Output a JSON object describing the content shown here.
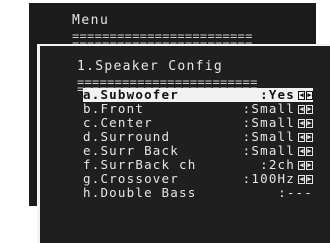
{
  "back_menu": {
    "title": "Menu",
    "separator": "========================"
  },
  "speaker_config": {
    "title": "1.Speaker Config",
    "separator": "========================",
    "items": [
      {
        "label": "a.Subwoofer",
        "value": ":Yes",
        "arrows": true,
        "selected": true
      },
      {
        "label": "b.Front",
        "value": ":Small",
        "arrows": true,
        "selected": false
      },
      {
        "label": "c.Center",
        "value": ":Small",
        "arrows": true,
        "selected": false
      },
      {
        "label": "d.Surround",
        "value": ":Small",
        "arrows": true,
        "selected": false
      },
      {
        "label": "e.Surr Back",
        "value": ":Small",
        "arrows": true,
        "selected": false
      },
      {
        "label": "f.SurrBack ch",
        "value": ":2ch",
        "arrows": true,
        "selected": false
      },
      {
        "label": "g.Crossover",
        "value": ":100Hz",
        "arrows": true,
        "selected": false
      },
      {
        "label": "h.Double Bass",
        "value": ":---",
        "arrows": false,
        "selected": false
      }
    ],
    "arrow_left": "◀",
    "arrow_right": "▶"
  },
  "colors": {
    "panel_bg": "#1f1f1f",
    "text": "#e6e6e6",
    "highlight_bg": "#f2f2f2",
    "highlight_text": "#111111"
  }
}
